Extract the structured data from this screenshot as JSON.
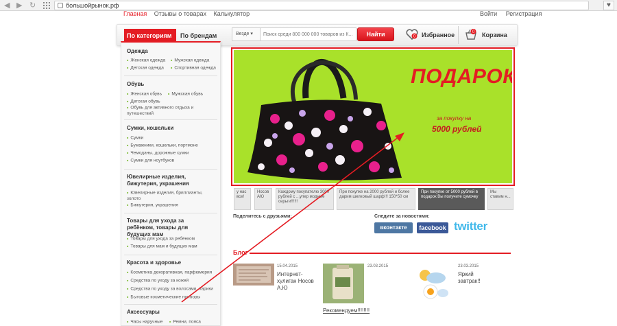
{
  "browser": {
    "url": "большойрынок.рф"
  },
  "top_links": [
    "Главная",
    "Отзывы о товарах",
    "Калькулятор"
  ],
  "user_links": [
    "Войти",
    "Регистрация"
  ],
  "header": {
    "tab_categories": "По категориям ▾",
    "tab_brands": "По брендам",
    "search_scope": "Везде ▾",
    "search_placeholder": "Поиск среди 800 000 000 товаров из К...",
    "search_button": "Найти",
    "favorites_label": "Избранное",
    "favorites_count": "0",
    "cart_label": "Корзина",
    "cart_count": "0"
  },
  "sidebar": [
    {
      "title": "Одежда",
      "items": [
        "Женская одежда",
        "Мужская одежда",
        "Детская одежда",
        "Спортивная одежда"
      ]
    },
    {
      "title": "Обувь",
      "items": [
        "Женская обувь",
        "Мужская обувь",
        "Детская обувь",
        "Обувь для активного отдыха и путешествий"
      ]
    },
    {
      "title": "Сумки, кошельки",
      "items": [
        "Сумки",
        "Бумажники, кошельки, портмоне",
        "Чемоданы, дорожные сумки",
        "Сумки для ноутбуков"
      ]
    },
    {
      "title": "Ювелирные изделия, бижутерия, украшения",
      "items": [
        "Ювелирные изделия, бриллианты, золото",
        "Бижутерия, украшения"
      ]
    },
    {
      "title": "Товары для ухода за ребёнком, товары для будущих мам",
      "items": [
        "Товары для ухода за ребёнком",
        "Товары для мам и будущих мам"
      ]
    },
    {
      "title": "Красота и здоровье",
      "items": [
        "Косметика декоративная, парфюмерия",
        "Средства по уходу за кожей",
        "Средства по уходу за волосами, парики",
        "Бытовые косметические приборы"
      ]
    },
    {
      "title": "Аксессуары",
      "items": [
        "Часы наручные",
        "Ремни, пояса"
      ]
    }
  ],
  "banner": {
    "title": "ПОДАРОК",
    "subtitle": "за покупку на",
    "price": "5000 рублей"
  },
  "thumbs": [
    {
      "text": "у нас все!"
    },
    {
      "text": "Носов АЮ"
    },
    {
      "text": "Каждому покупателю 3000 рублей с ...упер модные серьги!!!!!!"
    },
    {
      "text": "При покупке на 2000 рублей и более дарим шелковый шарф!!! 150*50 см"
    },
    {
      "text": "При покупке от 5000 рублей в подарок Вы получите сумочку"
    },
    {
      "text": "Мы ставим н..."
    }
  ],
  "social": {
    "share_label": "Поделитесь с друзьями:",
    "follow_label": "Следите за новостями:",
    "vk": "вконтакте",
    "facebook": "facebook",
    "twitter": "twitter"
  },
  "blog": {
    "title": "Блог",
    "posts": [
      {
        "date": "15.04.2015",
        "title": "Интернет-хулиган Носов А.Ю"
      },
      {
        "date": "23.03.2015",
        "title": "Рекомендуем!!!!!!!!"
      },
      {
        "date": "23.03.2015",
        "title": "Яркий завтрак!!"
      }
    ]
  },
  "colors": {
    "brand_red": "#e41c23",
    "banner_green": "#a9e12a"
  }
}
